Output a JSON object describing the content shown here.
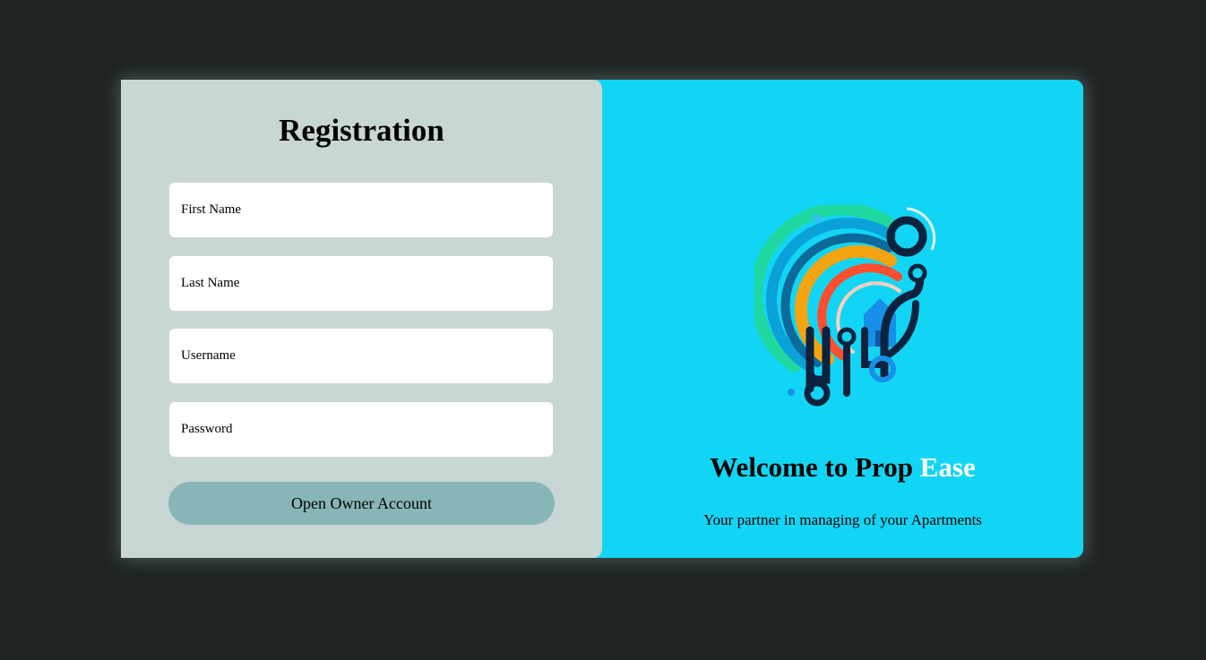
{
  "registration": {
    "title": "Registration",
    "fields": [
      {
        "placeholder": "First Name",
        "value": ""
      },
      {
        "placeholder": "Last Name",
        "value": ""
      },
      {
        "placeholder": "Username",
        "value": ""
      },
      {
        "placeholder": "Password",
        "value": ""
      }
    ],
    "submit_label": "Open Owner Account"
  },
  "welcome": {
    "heading_prefix": "Welcome to Prop ",
    "heading_accent": "Ease",
    "tagline": "Your partner in managing of your Apartments",
    "logo_icon": "prop-ease-logo-icon"
  },
  "colors": {
    "page_background": "#1e2424",
    "form_panel": "#c8d6d4",
    "welcome_panel": "#12d5f5",
    "submit_button": "#88b6b6",
    "accent_text": "#ffffff"
  }
}
